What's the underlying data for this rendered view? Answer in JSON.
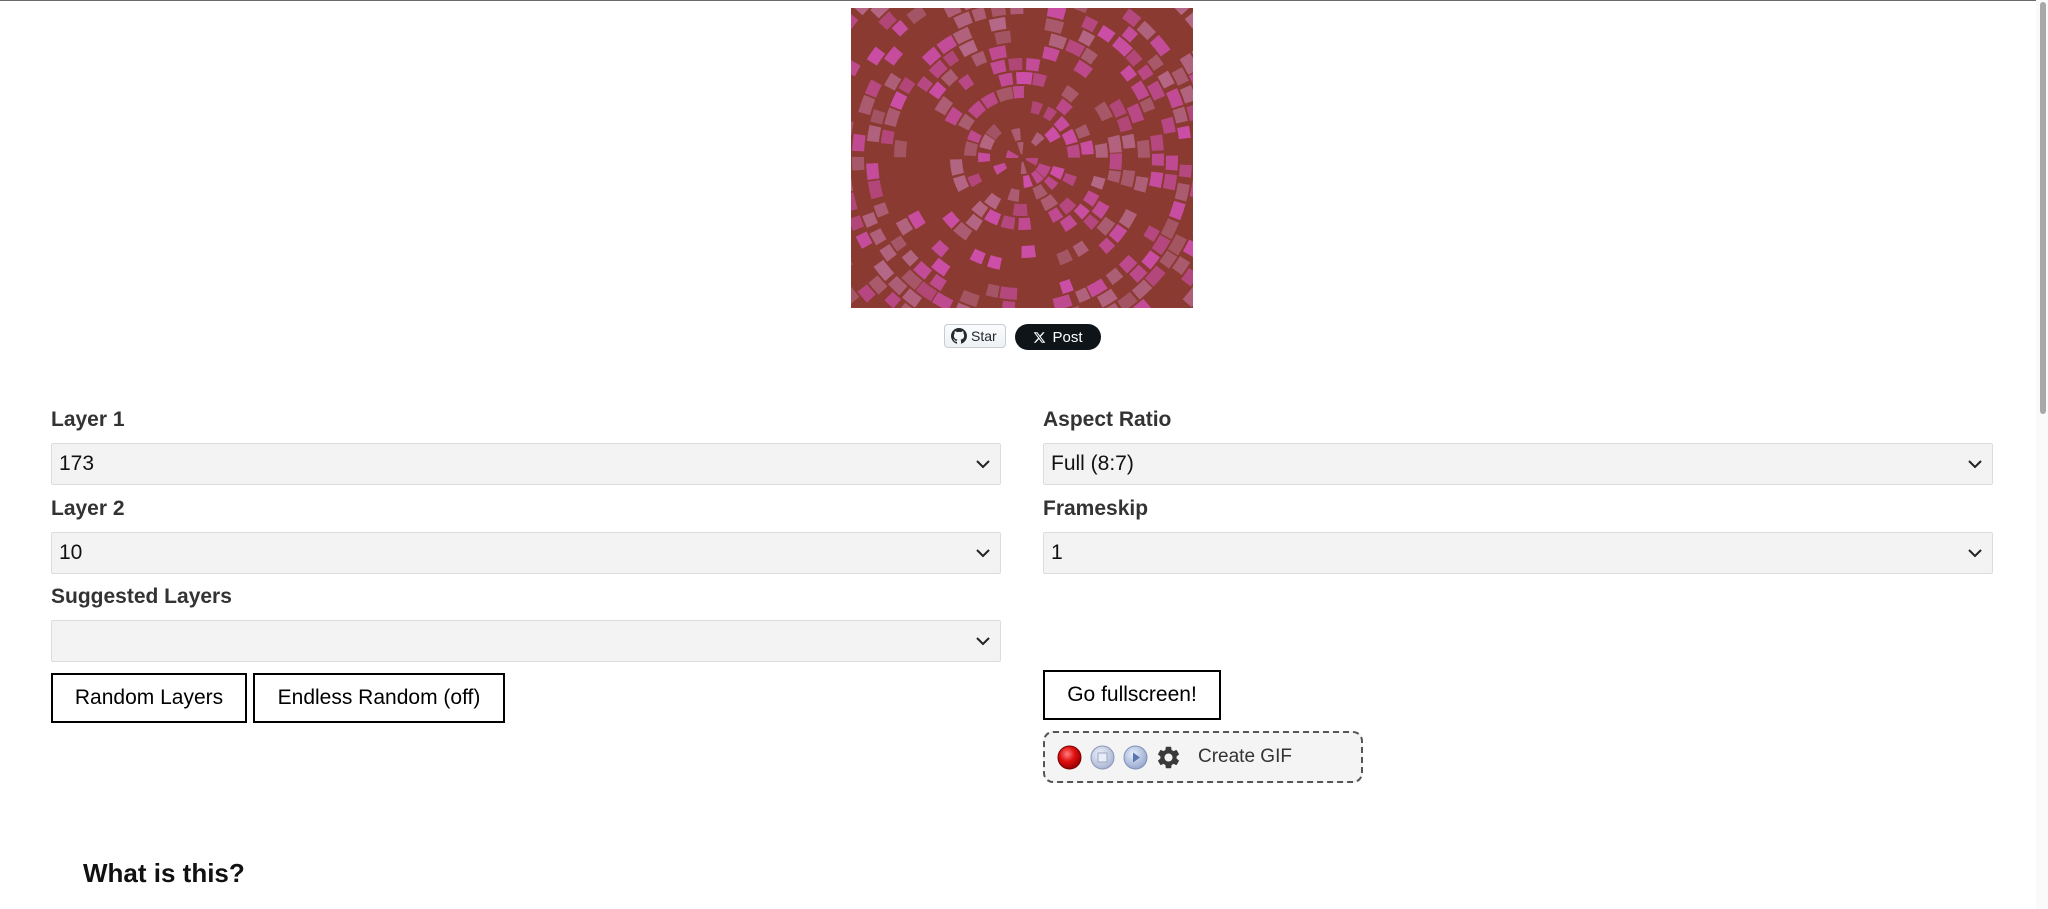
{
  "social": {
    "github_label": "Star",
    "x_label": "Post"
  },
  "controls": {
    "layer1": {
      "label": "Layer 1",
      "value": "173"
    },
    "layer2": {
      "label": "Layer 2",
      "value": "10"
    },
    "suggested": {
      "label": "Suggested Layers",
      "value": ""
    },
    "aspect": {
      "label": "Aspect Ratio",
      "value": "Full (8:7)"
    },
    "frameskip": {
      "label": "Frameskip",
      "value": "1"
    }
  },
  "buttons": {
    "random": "Random Layers",
    "endless": "Endless Random (off)",
    "fullscreen": "Go fullscreen!"
  },
  "gif": {
    "label": "Create GIF",
    "icons": [
      "record-icon",
      "stop-icon",
      "play-icon",
      "gear-icon"
    ]
  },
  "section": {
    "heading": "What is this?"
  },
  "colors": {
    "canvas_bg": "#8a3a30",
    "pattern_pink": "#d050b0",
    "pattern_mauve": "#b86a8c"
  }
}
